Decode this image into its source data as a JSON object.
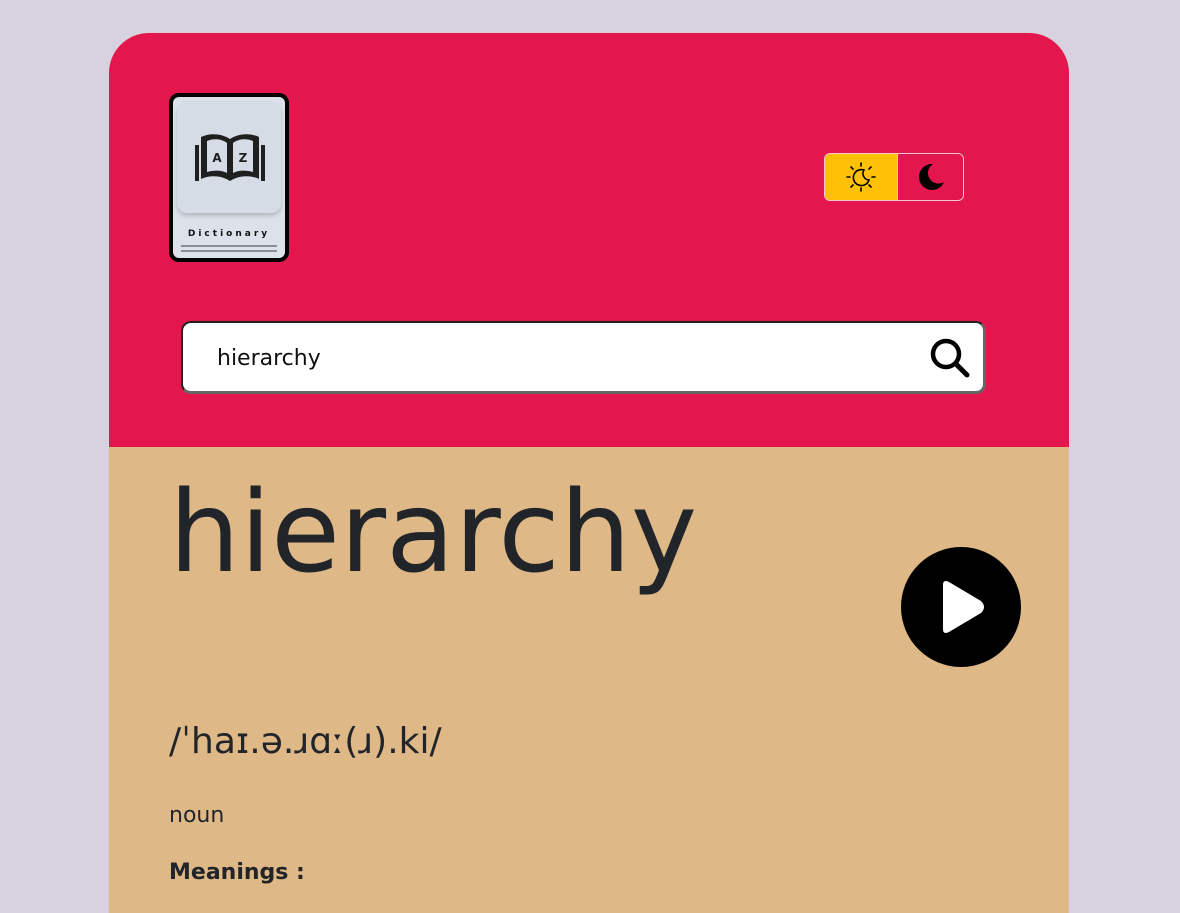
{
  "app": {
    "logo_text": "Dictionary"
  },
  "theme_toggle": {
    "light_icon": "sun-moon-icon",
    "dark_icon": "moon-icon",
    "active": "light",
    "light_color": "#ffc107",
    "header_color": "#e3174d"
  },
  "search": {
    "value": "hierarchy",
    "icon": "search-icon"
  },
  "result": {
    "word": "hierarchy",
    "phonetic": "/ˈhaɪ.ə.ɹɑː(ɹ).ki/",
    "part_of_speech": "noun",
    "meanings_label": "Meanings :",
    "play_icon": "play-icon"
  },
  "colors": {
    "page_bg": "#d8d1e0",
    "content_bg": "#deb887"
  }
}
